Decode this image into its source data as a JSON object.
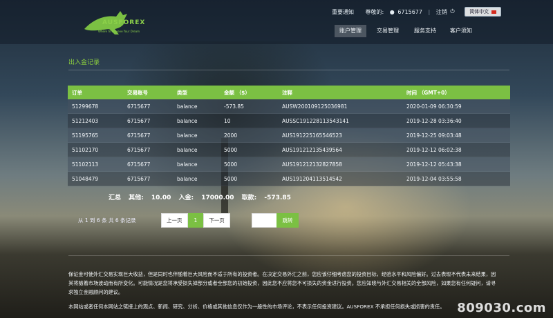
{
  "header": {
    "logo_text": "AUSFOREX",
    "logo_tagline": "Where To Achieve Your Dream",
    "links": {
      "notice": "重要通知",
      "greeting": "尊敬的:",
      "account": "6715677",
      "logout": "注销",
      "language": "简体中文"
    },
    "nav": [
      "账户管理",
      "交易管理",
      "服务支持",
      "客户须知"
    ],
    "active_nav_index": 0
  },
  "page_title": "出入金记录",
  "table": {
    "headers": [
      "订单",
      "交易账号",
      "类型",
      "金额 （$）",
      "注释",
      "时间 （GMT+0）"
    ],
    "rows": [
      [
        "51299678",
        "6715677",
        "balance",
        "-573.85",
        "AUSW200109125036981",
        "2020-01-09 06:30:59"
      ],
      [
        "51212403",
        "6715677",
        "balance",
        "10",
        "AUSSC191228113543141",
        "2019-12-28 03:36:40"
      ],
      [
        "51195765",
        "6715677",
        "balance",
        "2000",
        "AUS191225165546523",
        "2019-12-25 09:03:48"
      ],
      [
        "51102170",
        "6715677",
        "balance",
        "5000",
        "AUS191212135439564",
        "2019-12-12 06:02:38"
      ],
      [
        "51102113",
        "6715677",
        "balance",
        "5000",
        "AUS191212132827858",
        "2019-12-12 05:43:38"
      ],
      [
        "51048479",
        "6715677",
        "balance",
        "5000",
        "AUS191204113514542",
        "2019-12-04 03:55:58"
      ]
    ]
  },
  "summary": {
    "total_label": "汇总",
    "other_label": "其他:",
    "other_value": "10.00",
    "deposit_label": "入金:",
    "deposit_value": "17000.00",
    "withdraw_label": "取款:",
    "withdraw_value": "-573.85"
  },
  "pagination": {
    "info": "从 1 到 6 条 共 6 条记录",
    "prev": "上一页",
    "current": "1",
    "next": "下一页",
    "jump_value": "",
    "jump_button": "跳转"
  },
  "disclaimer": {
    "p1": "保证金可使外汇交易实现巨大收益，但是同时也伴随着巨大风险而不适于所有的投资者。在决定交易外汇之前，您应该仔细考虑您的投资目标，经验水平和风险偏好。过去表现不代表未来结果，因其将随着市场波动而有所变化。可能情况是您将承受损失掉部分或者全部您的初始投资，因此您不应将您不可损失的资金进行投资。您应知晓与外汇交易相关的全部风险，如果您有任何疑问，请寻求独立金融顾问的建议。",
    "p2": "本网站或者任何本网站之链接上的观点、新闻、研究、分析、价格或其他信息仅作为一般性的市场评论，不表示任何投资建议。AUSFOREX 不承担任何损失或损害的责任。"
  },
  "watermark": "809030.com",
  "colors": {
    "accent": "#7bc043",
    "title_green": "#8ed13f"
  }
}
